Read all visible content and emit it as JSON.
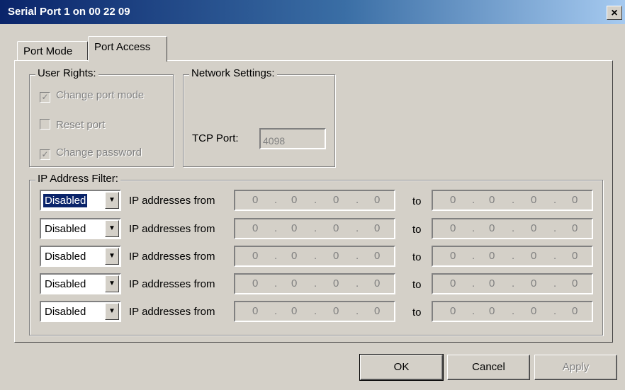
{
  "window": {
    "title": "Serial Port 1 on 00 22 09",
    "close_glyph": "×"
  },
  "tabs": [
    {
      "label": "Port Mode",
      "active": false
    },
    {
      "label": "Port Access",
      "active": true
    }
  ],
  "user_rights": {
    "legend": "User Rights:",
    "items": [
      {
        "label": "Change port mode",
        "checked": true,
        "enabled": false
      },
      {
        "label": "Reset port",
        "checked": false,
        "enabled": false
      },
      {
        "label": "Change password",
        "checked": true,
        "enabled": false
      }
    ]
  },
  "network_settings": {
    "legend": "Network Settings:",
    "tcp_label": "TCP Port:",
    "tcp_value": "4098"
  },
  "ip_filter": {
    "legend": "IP Address Filter:",
    "from_label": "IP addresses from",
    "to_label": "to",
    "octet_sep": ".",
    "rows": [
      {
        "mode": "Disabled",
        "from": [
          "0",
          "0",
          "0",
          "0"
        ],
        "to": [
          "0",
          "0",
          "0",
          "0"
        ]
      },
      {
        "mode": "Disabled",
        "from": [
          "0",
          "0",
          "0",
          "0"
        ],
        "to": [
          "0",
          "0",
          "0",
          "0"
        ]
      },
      {
        "mode": "Disabled",
        "from": [
          "0",
          "0",
          "0",
          "0"
        ],
        "to": [
          "0",
          "0",
          "0",
          "0"
        ]
      },
      {
        "mode": "Disabled",
        "from": [
          "0",
          "0",
          "0",
          "0"
        ],
        "to": [
          "0",
          "0",
          "0",
          "0"
        ]
      },
      {
        "mode": "Disabled",
        "from": [
          "0",
          "0",
          "0",
          "0"
        ],
        "to": [
          "0",
          "0",
          "0",
          "0"
        ]
      }
    ]
  },
  "buttons": {
    "ok": "OK",
    "cancel": "Cancel",
    "apply": "Apply"
  },
  "icons": {
    "checkmark": "check-icon",
    "dropdown": "dropdown-arrow-icon"
  }
}
